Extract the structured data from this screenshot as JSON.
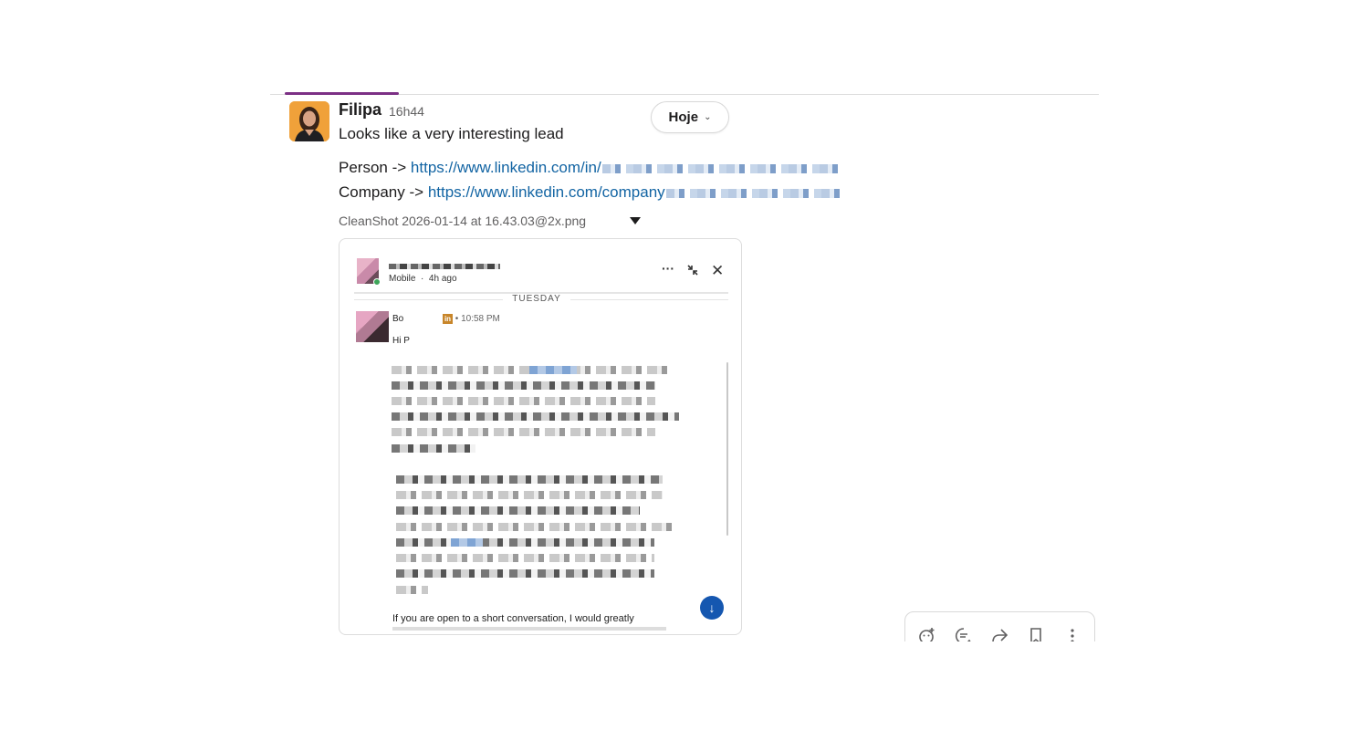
{
  "date_divider": {
    "label": "Hoje"
  },
  "message": {
    "author": "Filipa",
    "time": "16h44",
    "text": "Looks like a very interesting lead",
    "person_label": "Person ->",
    "person_link": "https://www.linkedin.com/in/",
    "company_label": "Company ->",
    "company_link": "https://www.linkedin.com/company"
  },
  "attachment": {
    "filename": "CleanShot 2026-01-14 at 16.43.03@2x.png",
    "preview": {
      "device_label": "Mobile",
      "device_time": "4h ago",
      "day_separator": "TUESDAY",
      "sender_prefix": "Bo",
      "linkedin_badge": "in",
      "sender_time": "• 10:58 PM",
      "greeting": "Hi P",
      "visible_text": "If you are open to a short conversation, I would greatly"
    }
  },
  "toolbar": {
    "icons": [
      "add-reaction-icon",
      "reply-thread-icon",
      "forward-icon",
      "bookmark-icon",
      "more-actions-icon"
    ]
  }
}
